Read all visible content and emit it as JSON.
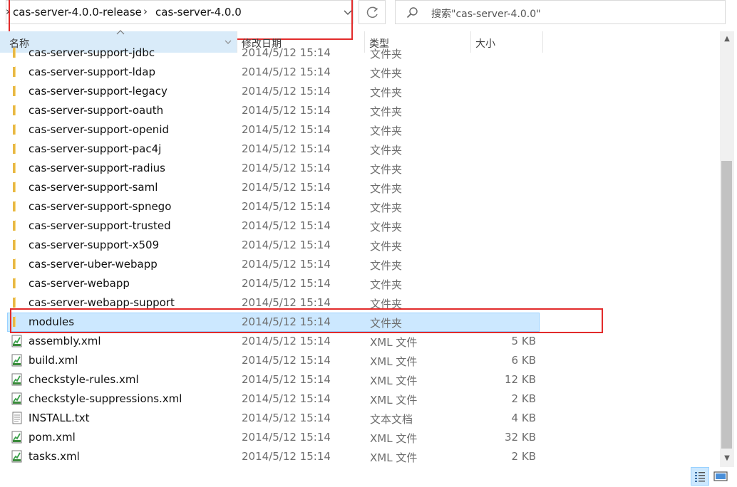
{
  "address_bar": {
    "crumbs": [
      "cas-server-4.0.0-release",
      "cas-server-4.0.0"
    ]
  },
  "search": {
    "placeholder": "搜索\"cas-server-4.0.0\""
  },
  "columns": {
    "name": "名称",
    "date": "修改日期",
    "type": "类型",
    "size": "大小"
  },
  "files": [
    {
      "name": "cas-server-support-jdbc",
      "date": "2014/5/12 15:14",
      "type": "文件夹",
      "size": "",
      "icon": "folder-icon"
    },
    {
      "name": "cas-server-support-ldap",
      "date": "2014/5/12 15:14",
      "type": "文件夹",
      "size": "",
      "icon": "folder-icon"
    },
    {
      "name": "cas-server-support-legacy",
      "date": "2014/5/12 15:14",
      "type": "文件夹",
      "size": "",
      "icon": "folder-icon"
    },
    {
      "name": "cas-server-support-oauth",
      "date": "2014/5/12 15:14",
      "type": "文件夹",
      "size": "",
      "icon": "folder-icon"
    },
    {
      "name": "cas-server-support-openid",
      "date": "2014/5/12 15:14",
      "type": "文件夹",
      "size": "",
      "icon": "folder-icon"
    },
    {
      "name": "cas-server-support-pac4j",
      "date": "2014/5/12 15:14",
      "type": "文件夹",
      "size": "",
      "icon": "folder-icon"
    },
    {
      "name": "cas-server-support-radius",
      "date": "2014/5/12 15:14",
      "type": "文件夹",
      "size": "",
      "icon": "folder-icon"
    },
    {
      "name": "cas-server-support-saml",
      "date": "2014/5/12 15:14",
      "type": "文件夹",
      "size": "",
      "icon": "folder-icon"
    },
    {
      "name": "cas-server-support-spnego",
      "date": "2014/5/12 15:14",
      "type": "文件夹",
      "size": "",
      "icon": "folder-icon"
    },
    {
      "name": "cas-server-support-trusted",
      "date": "2014/5/12 15:14",
      "type": "文件夹",
      "size": "",
      "icon": "folder-icon"
    },
    {
      "name": "cas-server-support-x509",
      "date": "2014/5/12 15:14",
      "type": "文件夹",
      "size": "",
      "icon": "folder-icon"
    },
    {
      "name": "cas-server-uber-webapp",
      "date": "2014/5/12 15:14",
      "type": "文件夹",
      "size": "",
      "icon": "folder-icon"
    },
    {
      "name": "cas-server-webapp",
      "date": "2014/5/12 15:14",
      "type": "文件夹",
      "size": "",
      "icon": "folder-icon"
    },
    {
      "name": "cas-server-webapp-support",
      "date": "2014/5/12 15:14",
      "type": "文件夹",
      "size": "",
      "icon": "folder-icon"
    },
    {
      "name": "modules",
      "date": "2014/5/12 15:14",
      "type": "文件夹",
      "size": "",
      "icon": "folder-icon",
      "selected": true
    },
    {
      "name": "assembly.xml",
      "date": "2014/5/12 15:14",
      "type": "XML 文件",
      "size": "5 KB",
      "icon": "xml-file-icon"
    },
    {
      "name": "build.xml",
      "date": "2014/5/12 15:14",
      "type": "XML 文件",
      "size": "6 KB",
      "icon": "xml-file-icon"
    },
    {
      "name": "checkstyle-rules.xml",
      "date": "2014/5/12 15:14",
      "type": "XML 文件",
      "size": "12 KB",
      "icon": "xml-file-icon"
    },
    {
      "name": "checkstyle-suppressions.xml",
      "date": "2014/5/12 15:14",
      "type": "XML 文件",
      "size": "2 KB",
      "icon": "xml-file-icon"
    },
    {
      "name": "INSTALL.txt",
      "date": "2014/5/12 15:14",
      "type": "文本文档",
      "size": "4 KB",
      "icon": "text-file-icon"
    },
    {
      "name": "pom.xml",
      "date": "2014/5/12 15:14",
      "type": "XML 文件",
      "size": "32 KB",
      "icon": "xml-file-icon"
    },
    {
      "name": "tasks.xml",
      "date": "2014/5/12 15:14",
      "type": "XML 文件",
      "size": "2 KB",
      "icon": "xml-file-icon"
    }
  ],
  "colors": {
    "highlight": "#e22b2b",
    "selection": "#cce8ff",
    "folder": "#f8d775"
  },
  "view_buttons": [
    "details-view-icon",
    "large-icons-view-icon"
  ]
}
